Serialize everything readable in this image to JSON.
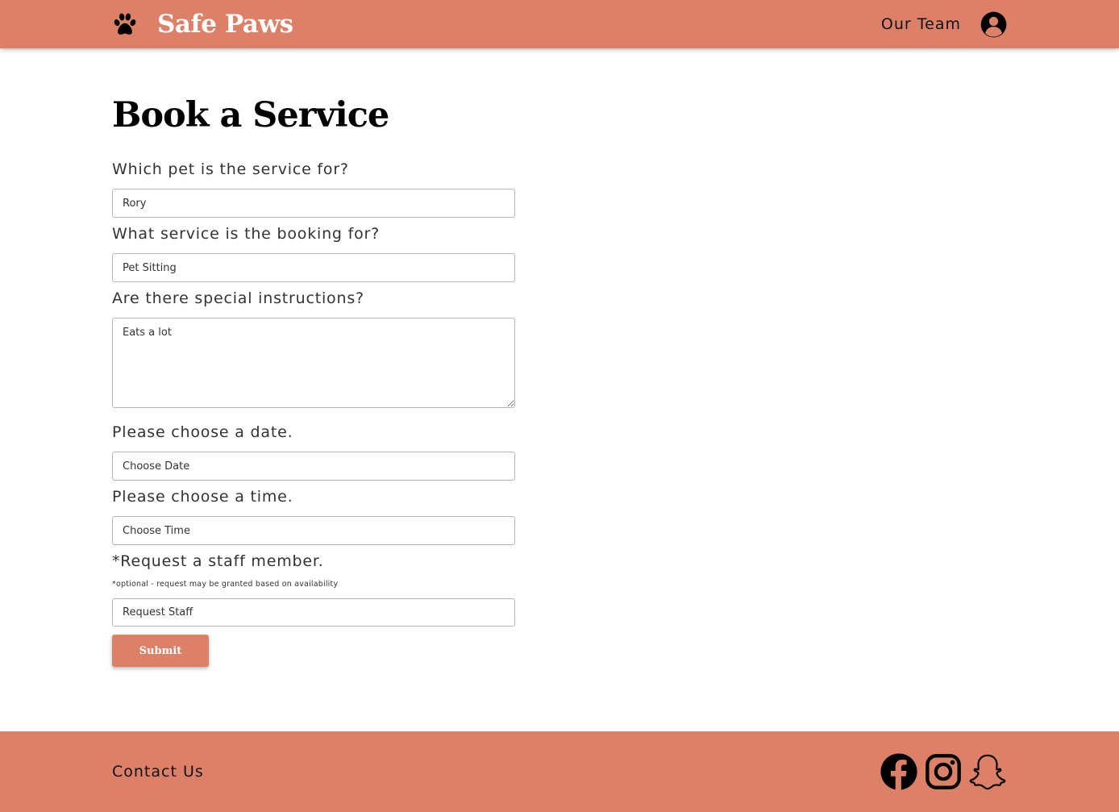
{
  "header": {
    "brand_name": "Safe Paws",
    "brand_icon": "paw-icon",
    "nav_link": "Our Team",
    "user_icon": "user-circle-icon"
  },
  "form": {
    "title": "Book a Service",
    "pet_label": "Which pet is the service for?",
    "pet_value": "Rory",
    "service_label": "What service is the booking for?",
    "service_value": "Pet Sitting",
    "instructions_label": "Are there special instructions?",
    "instructions_value": "Eats a lot",
    "date_label": "Please choose a date.",
    "date_placeholder": "Choose Date",
    "time_label": "Please choose a time.",
    "time_placeholder": "Choose Time",
    "staff_label": "*Request a staff member.",
    "staff_note": "*optional - request may be granted based on availability",
    "staff_placeholder": "Request Staff",
    "submit_label": "Submit"
  },
  "footer": {
    "contact_label": "Contact Us",
    "social_icons": [
      "facebook-icon",
      "instagram-icon",
      "snapchat-icon"
    ]
  },
  "colors": {
    "brand": "#dc8068",
    "white": "#ffffff",
    "text": "#111111"
  }
}
